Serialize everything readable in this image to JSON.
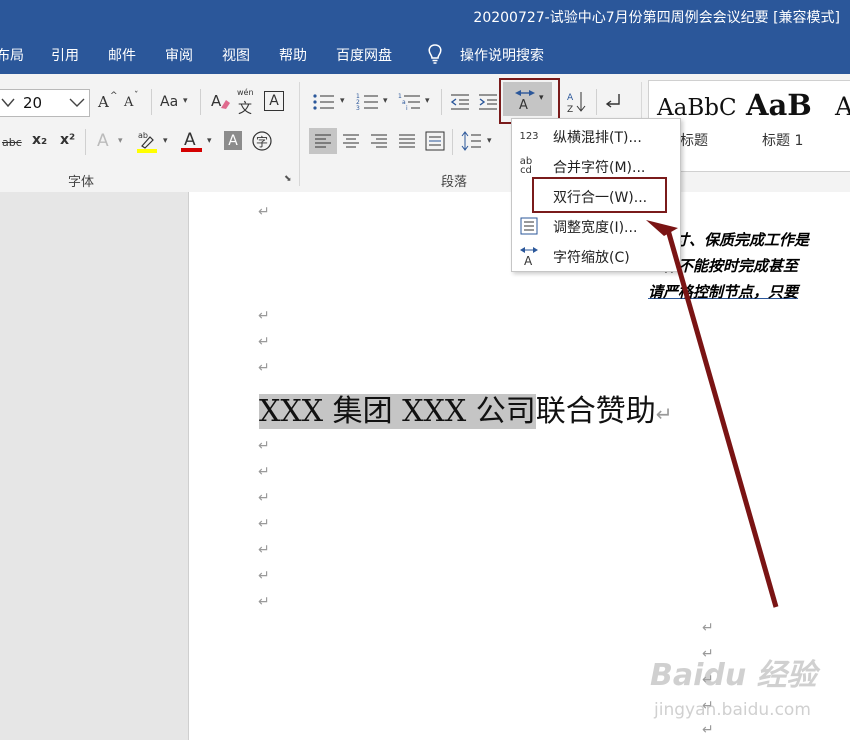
{
  "window": {
    "title": "20200727-试验中心7月份第四周例会会议纪要 [兼容模式]"
  },
  "menu": {
    "items": [
      "布局",
      "引用",
      "邮件",
      "审阅",
      "视图",
      "帮助",
      "百度网盘"
    ],
    "tell_me": "操作说明搜索"
  },
  "ribbon": {
    "font_size": "20",
    "font_group_label": "字体",
    "paragraph_group_label": "段落",
    "grow_font": "A",
    "shrink_font": "A",
    "change_case": "Aa",
    "phonetic": "wén",
    "strikethrough": "abc",
    "subscript": "x₂",
    "superscript": "x²",
    "styles": [
      {
        "preview": "AaBbC",
        "label": "标题"
      },
      {
        "preview": "AaB",
        "label": "标题 1"
      },
      {
        "preview": "A",
        "label": ""
      }
    ]
  },
  "dropdown": {
    "items": [
      {
        "icon": "123",
        "label": "纵横混排(T)..."
      },
      {
        "icon": "ab cd",
        "label": "合并字符(M)..."
      },
      {
        "icon": "",
        "label": "双行合一(W)..."
      },
      {
        "icon": "",
        "label": "调整宽度(I)..."
      },
      {
        "icon": "",
        "label": "字符缩放(C)"
      }
    ]
  },
  "document": {
    "paragraph_mark": "↵",
    "headline_highlighted": "XXX 集团 XXX 公司",
    "headline_rest": "联合赞助",
    "side_lines": [
      "寸、保质完成工作是",
      "工作不能按时完成甚至",
      "请严格控制节点，只要"
    ]
  },
  "watermark": {
    "brand": "Baidu 经验",
    "url": "jingyan.baidu.com"
  },
  "colors": {
    "title_bar": "#2b579a",
    "highlight_box": "#7a1b1b",
    "arrow": "#7a1414"
  }
}
